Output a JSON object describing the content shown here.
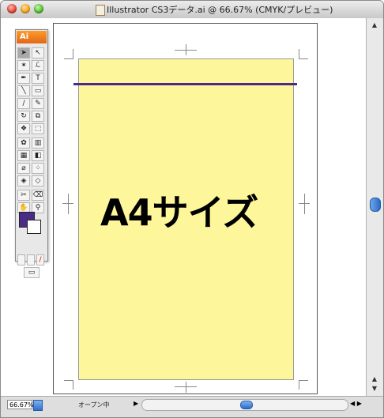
{
  "window": {
    "title": "Illustrator CS3データ.ai @ 66.67% (CMYK/プレビュー)"
  },
  "toolbox": {
    "logo": "Ai"
  },
  "document": {
    "main_text": "A4サイズ"
  },
  "status": {
    "zoom": "66.67%",
    "message": "オープン中"
  },
  "colors": {
    "page": "#fdf69a",
    "guide_line": "#4a2c86",
    "fill_swatch": "#4a2c86"
  }
}
